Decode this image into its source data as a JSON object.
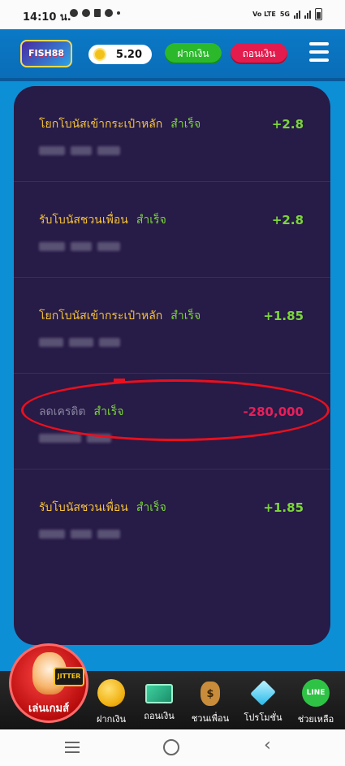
{
  "status_bar": {
    "time": "14:10 น.",
    "network": "5G",
    "volte": "Vo LTE"
  },
  "header": {
    "logo_text": "FISH88",
    "balance": "5.20",
    "deposit_label": "ฝากเงิน",
    "withdraw_label": "ถอนเงิน"
  },
  "transactions": [
    {
      "title": "โยกโบนัสเข้ากระเป๋าหลัก",
      "status": "สำเร็จ",
      "amount": "+2.8"
    },
    {
      "title": "รับโบนัสชวนเพื่อน",
      "status": "สำเร็จ",
      "amount": "+2.8"
    },
    {
      "title": "โยกโบนัสเข้ากระเป๋าหลัก",
      "status": "สำเร็จ",
      "amount": "+1.85"
    },
    {
      "title": "ลดเครดิต",
      "status": "สำเร็จ",
      "amount": "-280,000"
    },
    {
      "title": "รับโบนัสชวนเพื่อน",
      "status": "สำเร็จ",
      "amount": "+1.85"
    }
  ],
  "bottom_nav": {
    "play_label": "เล่นเกมส์",
    "play_sign": "JITTER",
    "items": [
      {
        "label": "ฝากเงิน",
        "icon": "coin-icon"
      },
      {
        "label": "ถอนเงิน",
        "icon": "cash-icon"
      },
      {
        "label": "ชวนเพื่อน",
        "icon": "money-bag-icon",
        "glyph": "$"
      },
      {
        "label": "โปรโมชั่น",
        "icon": "diamond-icon"
      },
      {
        "label": "ช่วยเหลือ",
        "icon": "line-icon",
        "glyph": "LINE"
      }
    ]
  },
  "colors": {
    "accent_blue": "#0d8fd6",
    "panel": "#271b47",
    "success_green": "#7bd63a",
    "title_gold": "#f6c33a",
    "negative_red": "#e6205a"
  }
}
